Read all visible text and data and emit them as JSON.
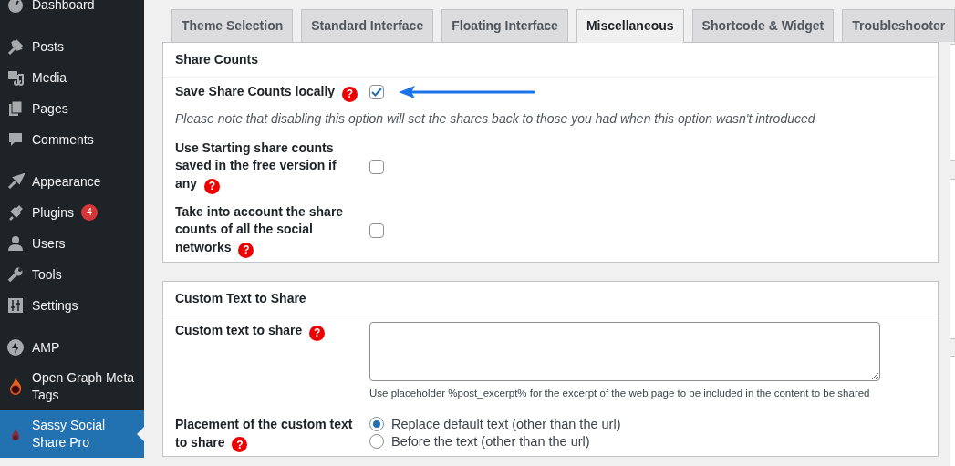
{
  "sidebar": {
    "groups": [
      {
        "items": [
          {
            "label": "Dashboard",
            "selected": false
          }
        ]
      },
      {
        "items": [
          {
            "label": "Posts",
            "selected": false
          },
          {
            "label": "Media",
            "selected": false
          },
          {
            "label": "Pages",
            "selected": false
          },
          {
            "label": "Comments",
            "selected": false
          }
        ]
      },
      {
        "items": [
          {
            "label": "Appearance",
            "selected": false
          },
          {
            "label": "Plugins",
            "badge": "4",
            "selected": false
          },
          {
            "label": "Users",
            "selected": false
          },
          {
            "label": "Tools",
            "selected": false
          },
          {
            "label": "Settings",
            "selected": false
          }
        ]
      },
      {
        "items": [
          {
            "label": "AMP",
            "selected": false
          },
          {
            "label": "Open Graph Meta Tags",
            "selected": false
          },
          {
            "label": "Sassy Social Share Pro",
            "selected": true
          }
        ]
      }
    ]
  },
  "tabs": [
    {
      "label": "Theme Selection",
      "selected": false
    },
    {
      "label": "Standard Interface",
      "selected": false
    },
    {
      "label": "Floating Interface",
      "selected": false
    },
    {
      "label": "Miscellaneous",
      "selected": true
    },
    {
      "label": "Shortcode & Widget",
      "selected": false
    },
    {
      "label": "Troubleshooter",
      "selected": false
    }
  ],
  "sections": [
    {
      "title": "Share Counts",
      "rows": [
        {
          "kind": "checkbox",
          "label": "Save Share Counts locally",
          "help": "?",
          "checked": true,
          "annotated": true,
          "note": "Please note that disabling this option will set the shares back to those you had when this option wasn't introduced"
        },
        {
          "kind": "checkbox",
          "label": "Use Starting share counts saved in the free version if any",
          "help": "?",
          "checked": false
        },
        {
          "kind": "checkbox",
          "label": "Take into account the share counts of all the social networks",
          "help": "?",
          "checked": false
        }
      ]
    },
    {
      "title": "Custom Text to Share",
      "rows": [
        {
          "kind": "textarea",
          "label": "Custom text to share",
          "help": "?",
          "hint": "Use placeholder %post_excerpt% for the excerpt of the web page to be included in the content to be shared"
        },
        {
          "kind": "radio",
          "label": "Placement of the custom text to share",
          "help": "?",
          "options": [
            {
              "label": "Replace default text (other than the url)",
              "selected": true
            },
            {
              "label": "Before the text (other than the url)",
              "selected": false
            }
          ]
        }
      ]
    }
  ]
}
